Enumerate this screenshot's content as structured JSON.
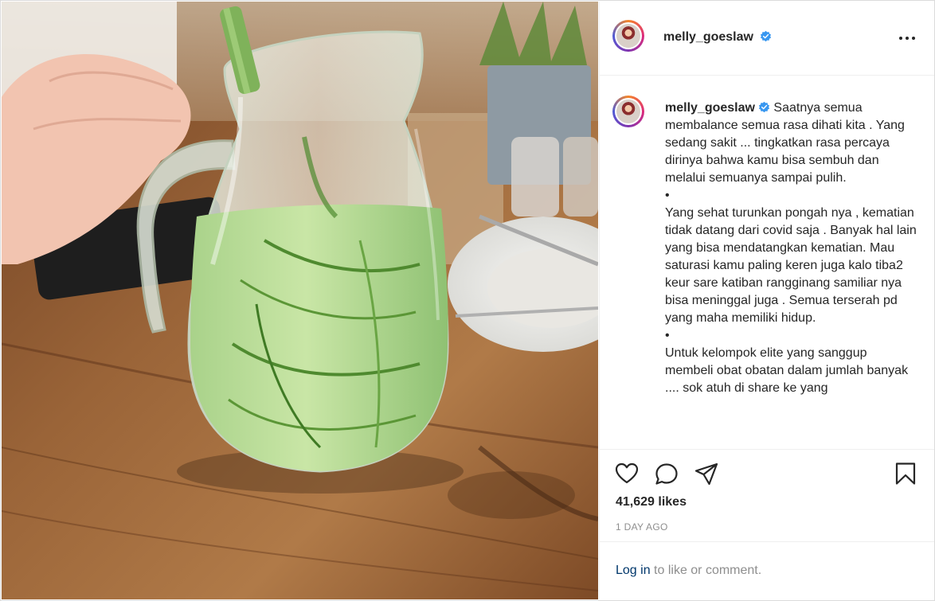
{
  "post": {
    "author": {
      "username": "melly_goeslaw",
      "verified": true,
      "verified_color": "#3897f0"
    },
    "photo": {
      "subject": "pitcher-of-cucumber-water"
    },
    "caption": "Saatnya semua membalance semua rasa dihati kita . Yang sedang sakit ... tingkatkan rasa percaya dirinya bahwa kamu bisa sembuh dan melalui semuanya sampai pulih.\n•\nYang sehat turunkan pongah nya , kematian tidak datang dari covid saja . Banyak hal lain yang bisa mendatangkan kematian. Mau saturasi kamu paling keren juga kalo tiba2 keur sare katiban rangginang samiliar nya bisa meninggal juga . Semua terserah pd yang maha memiliki hidup.\n•\nUntuk kelompok elite yang sanggup membeli obat obatan dalam jumlah banyak .... sok atuh di share ke yang",
    "likes": "41,629 likes",
    "date": "1 DAY AGO"
  },
  "icons": {
    "more": "more-options-icon",
    "like": "heart-icon",
    "comment": "comment-bubble-icon",
    "share": "paper-plane-icon",
    "save": "bookmark-icon",
    "verified": "verified-badge-icon"
  },
  "login_prompt": {
    "link": "Log in",
    "rest": " to like or comment."
  },
  "colors": {
    "link": "#00376b",
    "secondary_text": "#8e8e8e",
    "border": "#dbdbdb"
  }
}
